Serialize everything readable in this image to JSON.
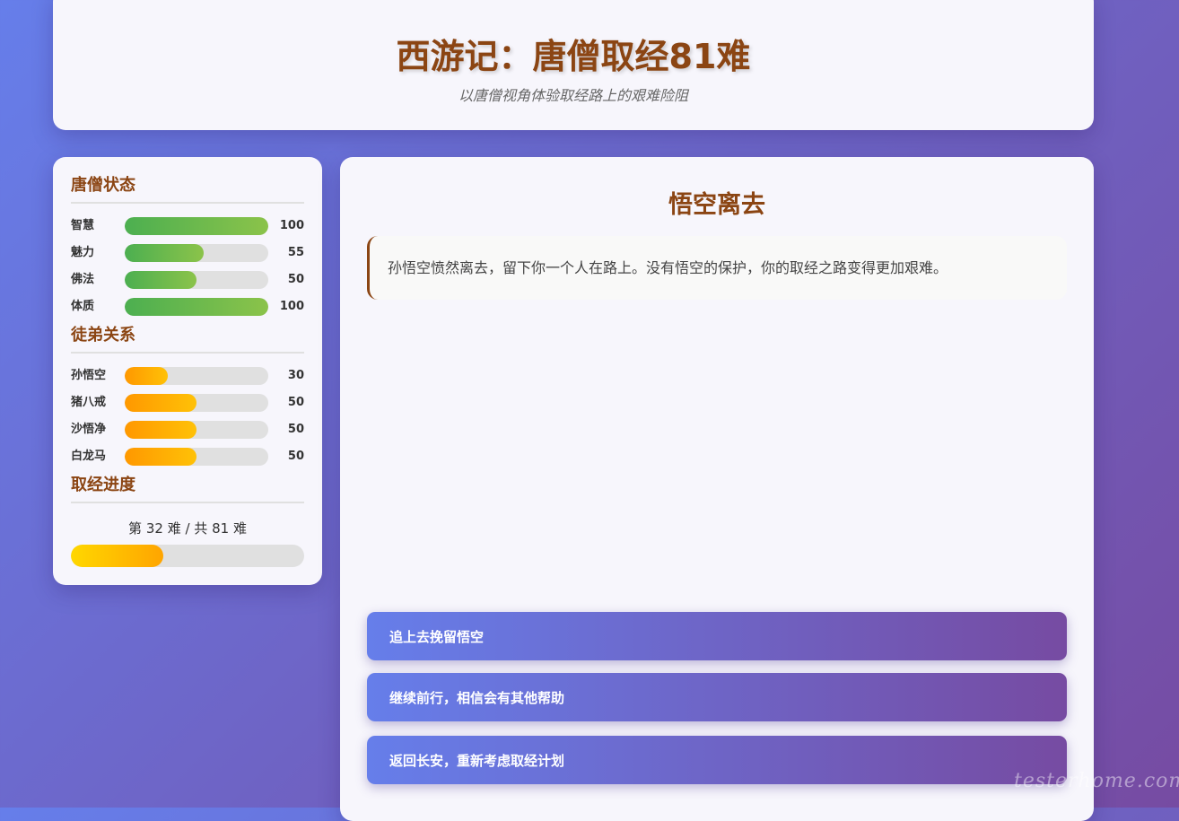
{
  "header": {
    "title": "西游记：唐僧取经81难",
    "subtitle": "以唐僧视角体验取经路上的艰难险阻"
  },
  "sidebar": {
    "status_title": "唐僧状态",
    "stats": [
      {
        "label": "智慧",
        "value": 100,
        "max": 100
      },
      {
        "label": "魅力",
        "value": 55,
        "max": 100
      },
      {
        "label": "佛法",
        "value": 50,
        "max": 100
      },
      {
        "label": "体质",
        "value": 100,
        "max": 100
      }
    ],
    "relations_title": "徒弟关系",
    "relations": [
      {
        "label": "孙悟空",
        "value": 30,
        "max": 100
      },
      {
        "label": "猪八戒",
        "value": 50,
        "max": 100
      },
      {
        "label": "沙悟净",
        "value": 50,
        "max": 100
      },
      {
        "label": "白龙马",
        "value": 50,
        "max": 100
      }
    ],
    "progress_title": "取经进度",
    "progress": {
      "prefix": "第",
      "current": "32",
      "middle": "难 / 共",
      "total": "81",
      "suffix": "难",
      "current_value": 32,
      "total_value": 81
    }
  },
  "main": {
    "event_title": "悟空离去",
    "event_text": "孙悟空愤然离去，留下你一个人在路上。没有悟空的保护，你的取经之路变得更加艰难。",
    "choices": [
      "追上去挽留悟空",
      "继续前行，相信会有其他帮助",
      "返回长安，重新考虑取经计划"
    ]
  },
  "colors": {
    "accent_brown": "#8b4513",
    "gradient_start": "#667eea",
    "gradient_end": "#764ba2",
    "stat_fill": "#4caf50",
    "relation_fill": "#ff9800",
    "progress_fill": "#ffd700"
  },
  "watermark": "testerhome.com"
}
